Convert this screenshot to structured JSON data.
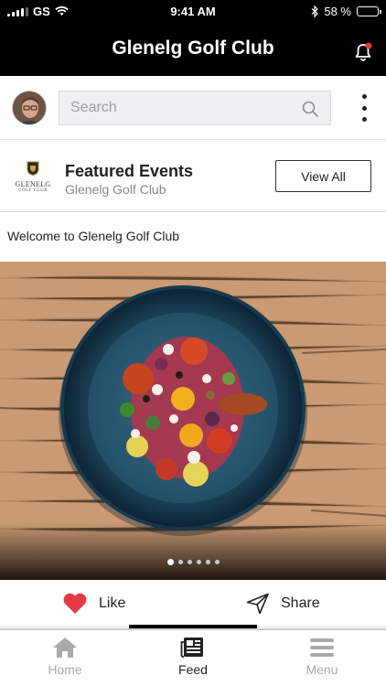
{
  "status_bar": {
    "carrier": "GS",
    "time": "9:41 AM",
    "battery_percent": "58 %",
    "battery_level": 0.58
  },
  "header": {
    "title": "Glenelg Golf Club",
    "notification_icon": "bell-icon",
    "notification_badge_color": "#e53935"
  },
  "search": {
    "placeholder": "Search",
    "value": ""
  },
  "featured": {
    "logo_name": "GLENELG",
    "logo_sub": "GOLF CLUB",
    "heading": "Featured Events",
    "subheading": "Glenelg Golf Club",
    "button_label": "View All"
  },
  "post": {
    "text": "Welcome to Glenelg Golf Club",
    "image_description_icon": "food-plate-image",
    "carousel_total": 6,
    "carousel_active": 1,
    "like_label": "Like",
    "share_label": "Share",
    "like_color": "#e53945"
  },
  "tabs": [
    {
      "label": "Home",
      "icon": "home-icon",
      "active": false
    },
    {
      "label": "Feed",
      "icon": "newspaper-icon",
      "active": true
    },
    {
      "label": "Menu",
      "icon": "menu-icon",
      "active": false
    }
  ],
  "colors": {
    "header_bg": "#000000",
    "accent": "#000000",
    "inactive_tab": "#aaaaaa"
  }
}
